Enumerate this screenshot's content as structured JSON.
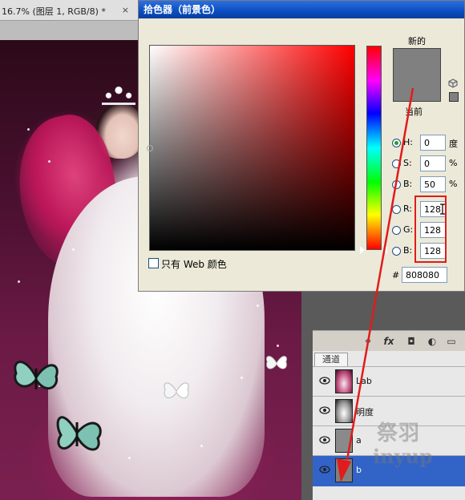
{
  "document": {
    "tab_title": "16.7% (图层 1, RGB/8) *",
    "close_glyph": "×"
  },
  "picker": {
    "title": "拾色器（前景色）",
    "new_label": "新的",
    "current_label": "当前",
    "new_color": "#808080",
    "current_color": "#808080",
    "fields": {
      "h": {
        "label": "H:",
        "value": "0",
        "unit": "度",
        "selected": true
      },
      "s": {
        "label": "S:",
        "value": "0",
        "unit": "%"
      },
      "b": {
        "label": "B:",
        "value": "50",
        "unit": "%"
      },
      "r": {
        "label": "R:",
        "value": "128"
      },
      "g": {
        "label": "G:",
        "value": "128"
      },
      "bl": {
        "label": "B:",
        "value": "128"
      }
    },
    "hex_label": "#",
    "hex_value": "808080",
    "web_only_label": "只有 Web 颜色"
  },
  "layers": {
    "channels_tab": "通道",
    "rows": [
      {
        "name": "Lab",
        "selected": false
      },
      {
        "name": "明度",
        "selected": false
      },
      {
        "name": "a",
        "selected": false
      },
      {
        "name": "b",
        "selected": true
      }
    ]
  },
  "watermark": {
    "line1": "祭羽",
    "line2": "inyup"
  },
  "colors": {
    "highlight": "#e21b1b",
    "selection": "#3264c8",
    "title_bar": "#0a4dc0"
  }
}
